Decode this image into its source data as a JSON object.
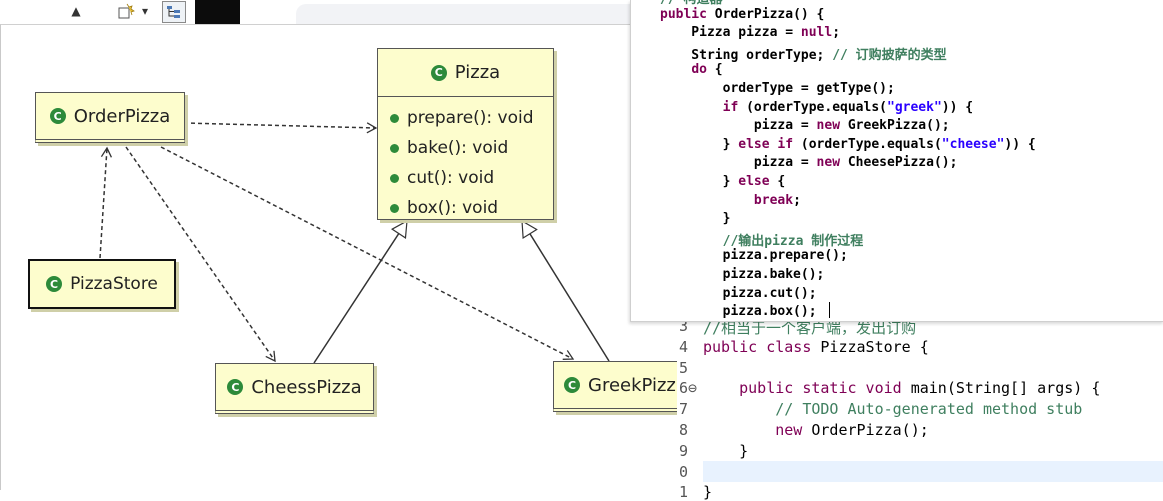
{
  "toolbar": {
    "arrow_label": "▲",
    "new_icon": "new-class-icon",
    "dropdown_label": "▾",
    "outline_icon": "outline-icon"
  },
  "diagram": {
    "pizza": {
      "name": "Pizza",
      "methods": [
        "prepare(): void",
        "bake(): void",
        "cut(): void",
        "box(): void"
      ]
    },
    "order_pizza": "OrderPizza",
    "pizza_store": "PizzaStore",
    "cheess_pizza": "CheessPizza",
    "greek_pizza": "GreekPizz",
    "class_icon_letter": "C",
    "colors": {
      "class_fill": "#fdfdcd",
      "icon_green": "#2d8a3a"
    }
  },
  "code_top": {
    "lines": [
      [
        {
          "t": "// 构造器",
          "c": "cmt"
        }
      ],
      [
        {
          "t": "public ",
          "c": "kw"
        },
        {
          "t": "OrderPizza() {",
          "c": ""
        }
      ],
      [
        {
          "t": "    Pizza pizza = ",
          "c": ""
        },
        {
          "t": "null",
          "c": "kw"
        },
        {
          "t": ";",
          "c": ""
        }
      ],
      [
        {
          "t": "    String orderType; ",
          "c": ""
        },
        {
          "t": "// 订购披萨的类型",
          "c": "cmt"
        }
      ],
      [
        {
          "t": "    ",
          "c": ""
        },
        {
          "t": "do",
          "c": "kw"
        },
        {
          "t": " {",
          "c": ""
        }
      ],
      [
        {
          "t": "        orderType = getType();",
          "c": ""
        }
      ],
      [
        {
          "t": "        ",
          "c": ""
        },
        {
          "t": "if",
          "c": "kw"
        },
        {
          "t": " (orderType.equals(",
          "c": ""
        },
        {
          "t": "\"greek\"",
          "c": "str"
        },
        {
          "t": ")) {",
          "c": ""
        }
      ],
      [
        {
          "t": "            pizza = ",
          "c": ""
        },
        {
          "t": "new",
          "c": "kw"
        },
        {
          "t": " GreekPizza();",
          "c": ""
        }
      ],
      [
        {
          "t": "        } ",
          "c": ""
        },
        {
          "t": "else if",
          "c": "kw"
        },
        {
          "t": " (orderType.equals(",
          "c": ""
        },
        {
          "t": "\"cheese\"",
          "c": "str"
        },
        {
          "t": ")) {",
          "c": ""
        }
      ],
      [
        {
          "t": "            pizza = ",
          "c": ""
        },
        {
          "t": "new",
          "c": "kw"
        },
        {
          "t": " CheesePizza();",
          "c": ""
        }
      ],
      [
        {
          "t": "        } ",
          "c": ""
        },
        {
          "t": "else",
          "c": "kw"
        },
        {
          "t": " {",
          "c": ""
        }
      ],
      [
        {
          "t": "            ",
          "c": ""
        },
        {
          "t": "break",
          "c": "kw"
        },
        {
          "t": ";",
          "c": ""
        }
      ],
      [
        {
          "t": "        }",
          "c": ""
        }
      ],
      [
        {
          "t": "        //输出pizza 制作过程",
          "c": "cmt"
        }
      ],
      [
        {
          "t": "        pizza.prepare();",
          "c": ""
        }
      ],
      [
        {
          "t": "        pizza.bake();",
          "c": ""
        }
      ],
      [
        {
          "t": "        pizza.cut();",
          "c": ""
        }
      ],
      [
        {
          "t": "        pizza.box();",
          "c": ""
        }
      ]
    ]
  },
  "code_bottom": {
    "line_numbers": [
      "3",
      "4",
      "5",
      "6⊖",
      "7",
      "8",
      "9",
      "0",
      "1"
    ],
    "lines": [
      [
        {
          "t": "//相当于一个客户端，发出订购",
          "c": "cmt"
        }
      ],
      [
        {
          "t": "public class ",
          "c": "kw"
        },
        {
          "t": "PizzaStore {",
          "c": ""
        }
      ],
      [
        {
          "t": "",
          "c": ""
        }
      ],
      [
        {
          "t": "    ",
          "c": ""
        },
        {
          "t": "public static void ",
          "c": "kw"
        },
        {
          "t": "main(String[] args) {",
          "c": ""
        }
      ],
      [
        {
          "t": "        // ",
          "c": "cmt"
        },
        {
          "t": "TODO",
          "c": "cmt"
        },
        {
          "t": " Auto-generated method stub",
          "c": "cmt"
        }
      ],
      [
        {
          "t": "        ",
          "c": ""
        },
        {
          "t": "new ",
          "c": "kw"
        },
        {
          "t": "OrderPizza();",
          "c": ""
        }
      ],
      [
        {
          "t": "    }",
          "c": ""
        }
      ],
      [
        {
          "t": "",
          "c": ""
        }
      ],
      [
        {
          "t": "}",
          "c": ""
        }
      ]
    ]
  }
}
